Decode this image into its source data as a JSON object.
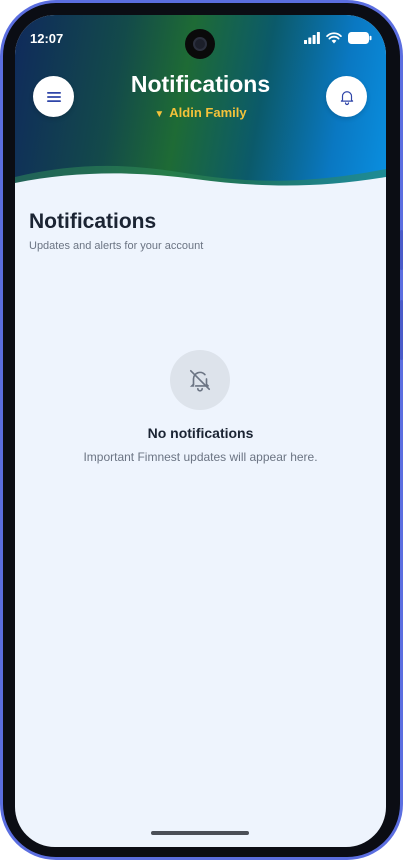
{
  "status_bar": {
    "time": "12:07",
    "icons": [
      "signal-icon",
      "wifi-icon",
      "battery-icon"
    ]
  },
  "header": {
    "title": "Notifications",
    "family_selector": {
      "indicator": "▼",
      "label": "Aldin Family"
    },
    "menu_icon": "hamburger-menu-icon",
    "bell_icon": "bell-icon"
  },
  "main": {
    "title": "Notifications",
    "subtitle": "Updates and alerts for your account",
    "empty_state": {
      "icon": "bell-off-icon",
      "title": "No notifications",
      "description": "Important Fimnest updates will appear here."
    }
  },
  "colors": {
    "accent_yellow": "#f4c23a",
    "menu_blue": "#2f45a8",
    "background": "#eef4fd",
    "phone_frame": "#5b6ee0"
  }
}
